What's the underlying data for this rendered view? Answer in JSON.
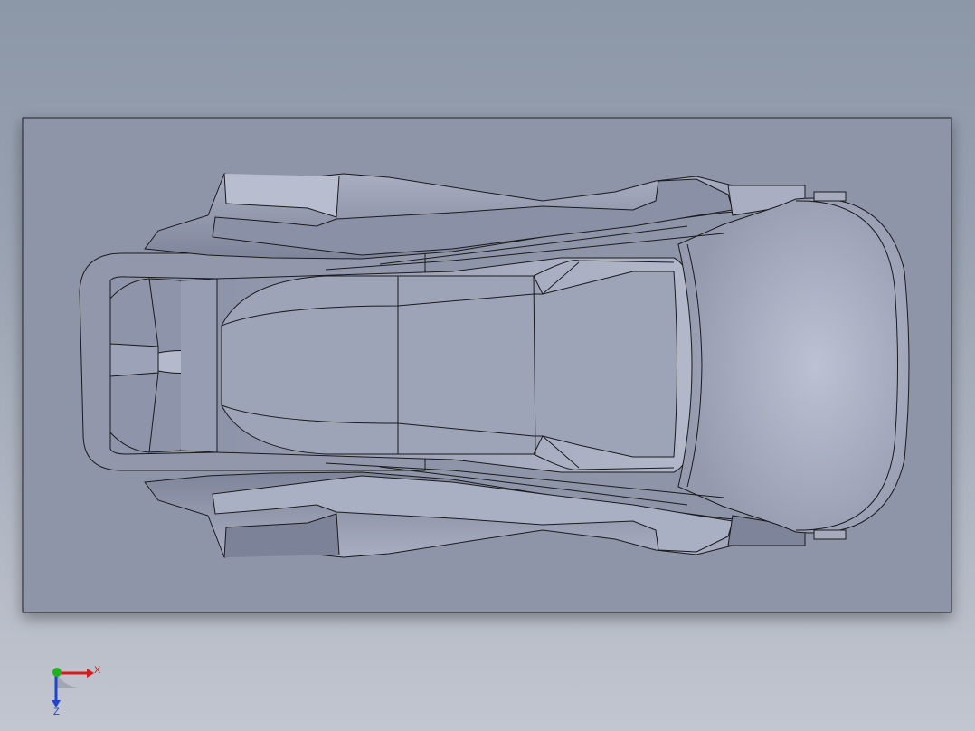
{
  "viewport": {
    "background_top": "#8c97a8",
    "background_bottom": "#c2c6d0",
    "plate_color": "#8f95a8",
    "body_color": "#9aa0b6",
    "body_highlight": "#b9bed0",
    "edge_color": "#1a1a1a"
  },
  "triad": {
    "x_label": "X",
    "z_label": "Z",
    "x_color": "#d81c1c",
    "y_color": "#22b022",
    "z_color": "#2244cc"
  }
}
